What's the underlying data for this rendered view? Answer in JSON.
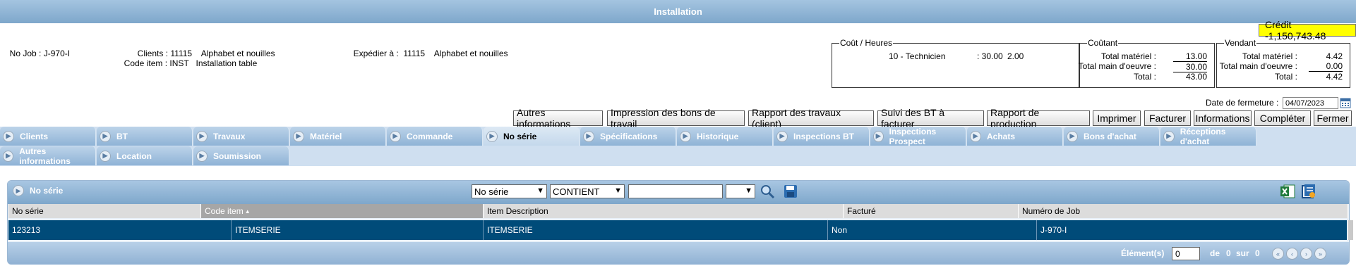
{
  "title": "Installation",
  "credit": "Crédit -1,150,743.48",
  "job": {
    "label": "No Job :",
    "value": "J-970-I"
  },
  "client": {
    "label": "Clients :",
    "number": "11115",
    "name": "Alphabet et nouilles"
  },
  "code_item": {
    "label": "Code item :",
    "code": "INST",
    "description": "Installation table"
  },
  "ship": {
    "label": "Expédier à :",
    "number": "11115",
    "name": "Alphabet et nouilles"
  },
  "cout_heures": {
    "legend": "Coût / Heures",
    "line": {
      "name": "10 - Technicien",
      "rate": ": 30.00",
      "hours": "2.00"
    }
  },
  "coutant": {
    "legend": "Coûtant",
    "rows": [
      {
        "label": "Total matériel :",
        "value": "13.00"
      },
      {
        "label": "Total main d'oeuvre :",
        "value": "30.00"
      },
      {
        "label": "Total :",
        "value": "43.00"
      }
    ]
  },
  "vendant": {
    "legend": "Vendant",
    "rows": [
      {
        "label": "Total matériel :",
        "value": "4.42"
      },
      {
        "label": "Total main d'oeuvre :",
        "value": "0.00"
      },
      {
        "label": "Total :",
        "value": "4.42"
      }
    ]
  },
  "closing_date": {
    "label": "Date de fermeture :",
    "value": "04/07/2023"
  },
  "actions": [
    "Autres informations",
    "Impression des bons de travail",
    "Rapport des travaux (client)",
    "Suivi des BT à facturer",
    "Rapport de production",
    "Imprimer",
    "Facturer",
    "Informations",
    "Compléter",
    "Fermer"
  ],
  "tabs_row1": [
    "Clients",
    "BT",
    "Travaux",
    "Matériel",
    "Commande",
    "No série",
    "Spécifications",
    "Historique",
    "Inspections BT",
    "Inspections Prospect",
    "Achats",
    "Bons d'achat",
    "Réceptions d'achat"
  ],
  "tabs_row2": [
    "Autres informations",
    "Location",
    "Soumission"
  ],
  "active_tab": "No série",
  "grid": {
    "title": "No série",
    "filter_field": "No série",
    "filter_op": "CONTIENT",
    "filter_value": "",
    "columns": [
      "No série",
      "Code item",
      "Item Description",
      "Facturé",
      "Numéro de Job"
    ],
    "rows": [
      [
        "123213",
        "ITEMSERIE",
        "ITEMSERIE",
        "Non",
        "J-970-I"
      ]
    ],
    "pager": {
      "label": "Élément(s)",
      "value": "0",
      "of_label": "de",
      "of_value": "0",
      "on_label": "sur",
      "on_value": "0"
    }
  },
  "colors": {
    "accent": "#7ea7cb",
    "selected_row": "#004b79",
    "credit_bg": "#ffff00"
  }
}
